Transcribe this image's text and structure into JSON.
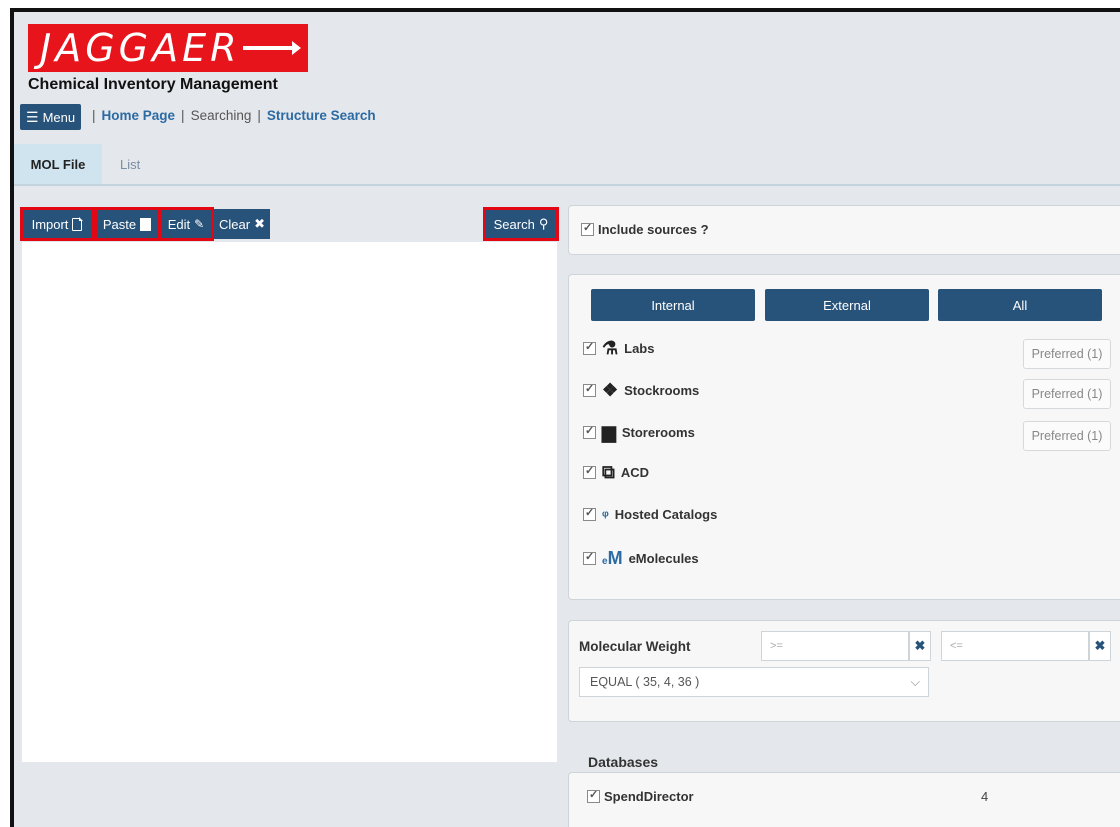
{
  "header": {
    "logo_text": "JAGGAER",
    "app_title": "Chemical Inventory Management",
    "menu_label": "Menu"
  },
  "breadcrumb": {
    "home": "Home Page",
    "searching": "Searching",
    "structure_search": "Structure Search"
  },
  "tabs": [
    "MOL File",
    "List"
  ],
  "toolbar": {
    "import_label": "Import",
    "paste_label": "Paste",
    "edit_label": "Edit",
    "clear_label": "Clear",
    "search_label": "Search"
  },
  "include_sources": {
    "label": "Include sources ?",
    "checked": true
  },
  "source_filter": {
    "buttons": [
      "Internal",
      "External",
      "All"
    ],
    "sources": [
      {
        "label": "Labs",
        "icon": "flask-icon",
        "checked": true,
        "preferred": "Preferred (1)"
      },
      {
        "label": "Stockrooms",
        "icon": "cubes-icon",
        "checked": true,
        "preferred": "Preferred (1)"
      },
      {
        "label": "Storerooms",
        "icon": "archive-icon",
        "checked": true,
        "preferred": "Preferred (1)"
      },
      {
        "label": "ACD",
        "icon": "external-link-icon",
        "checked": true
      },
      {
        "label": "Hosted Catalogs",
        "icon": "hosted-catalogs-icon",
        "checked": true
      },
      {
        "label": "eMolecules",
        "icon": "emolecules-icon",
        "checked": true
      }
    ]
  },
  "molecular_weight": {
    "label": "Molecular Weight",
    "min_placeholder": ">=",
    "max_placeholder": "<=",
    "operator_value": "EQUAL ( 35, 4, 36 )"
  },
  "databases": {
    "title": "Databases",
    "items": [
      {
        "label": "SpendDirector",
        "count": "4",
        "checked": true
      }
    ]
  },
  "colors": {
    "accent": "#27527a",
    "highlight": "#e30613",
    "logo": "#e8141c"
  }
}
